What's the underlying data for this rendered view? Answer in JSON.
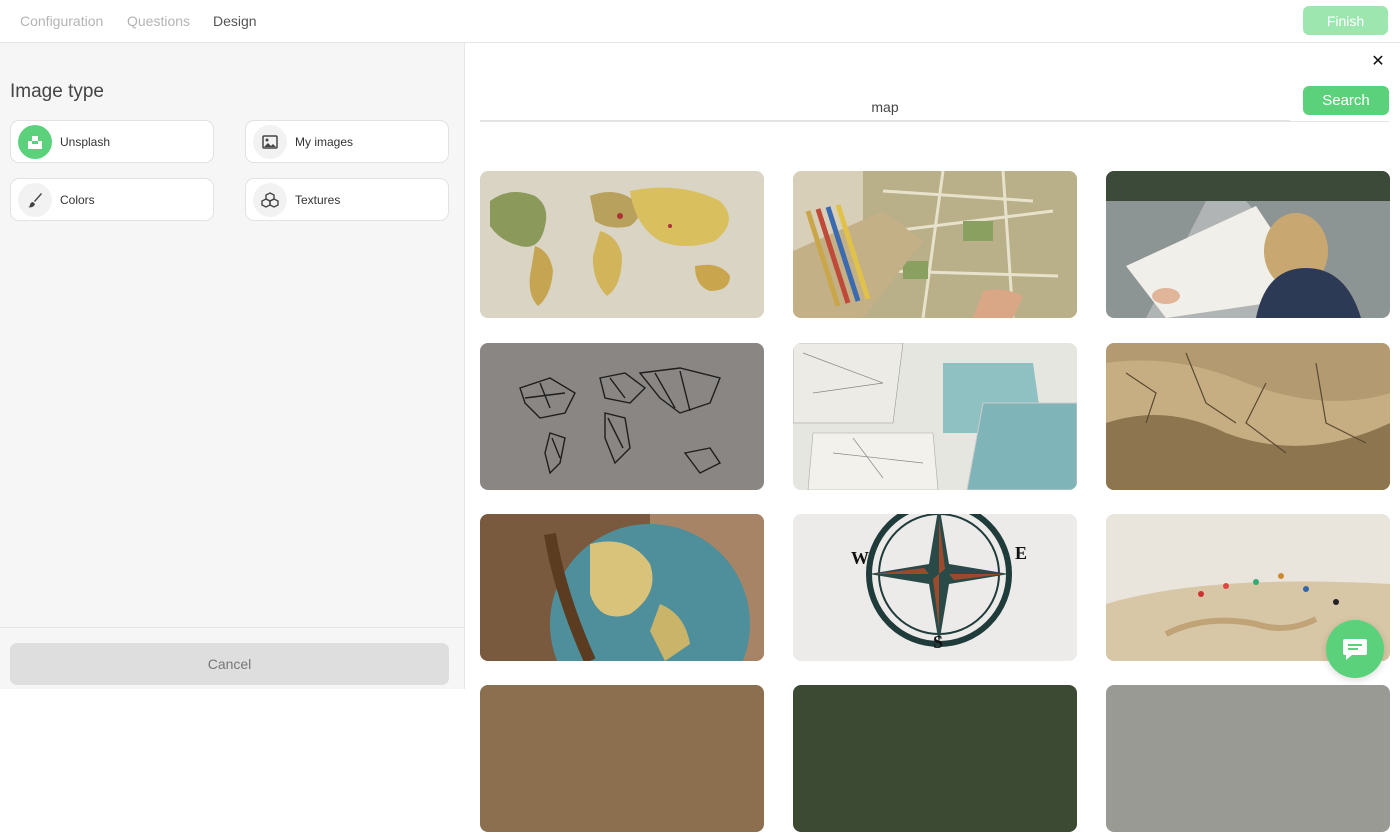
{
  "topbar": {
    "tabs": [
      {
        "label": "Configuration"
      },
      {
        "label": "Questions"
      },
      {
        "label": "Design"
      }
    ],
    "active_tab": "Design",
    "finish_label": "Finish"
  },
  "sidebar": {
    "title": "Image type",
    "types": [
      {
        "label": "Unsplash",
        "icon": "unsplash-icon",
        "selected": true
      },
      {
        "label": "My images",
        "icon": "image-icon",
        "selected": false
      },
      {
        "label": "Colors",
        "icon": "brush-icon",
        "selected": false
      },
      {
        "label": "Textures",
        "icon": "cubes-icon",
        "selected": false
      }
    ],
    "cancel_label": "Cancel"
  },
  "search": {
    "query": "map",
    "button_label": "Search"
  },
  "results": [
    {
      "subject": "world-map"
    },
    {
      "subject": "city-map-with-pencils"
    },
    {
      "subject": "woman-reading-map-on-road"
    },
    {
      "subject": "geometric-world-map"
    },
    {
      "subject": "scattered-nautical-maps"
    },
    {
      "subject": "topographic-relief-map"
    },
    {
      "subject": "globe"
    },
    {
      "subject": "compass-rose",
      "text": [
        "W",
        "E",
        "S"
      ]
    },
    {
      "subject": "map-with-pins"
    }
  ],
  "colors": {
    "accent": "#5cd17c",
    "accent_disabled": "#9ee6b0"
  }
}
